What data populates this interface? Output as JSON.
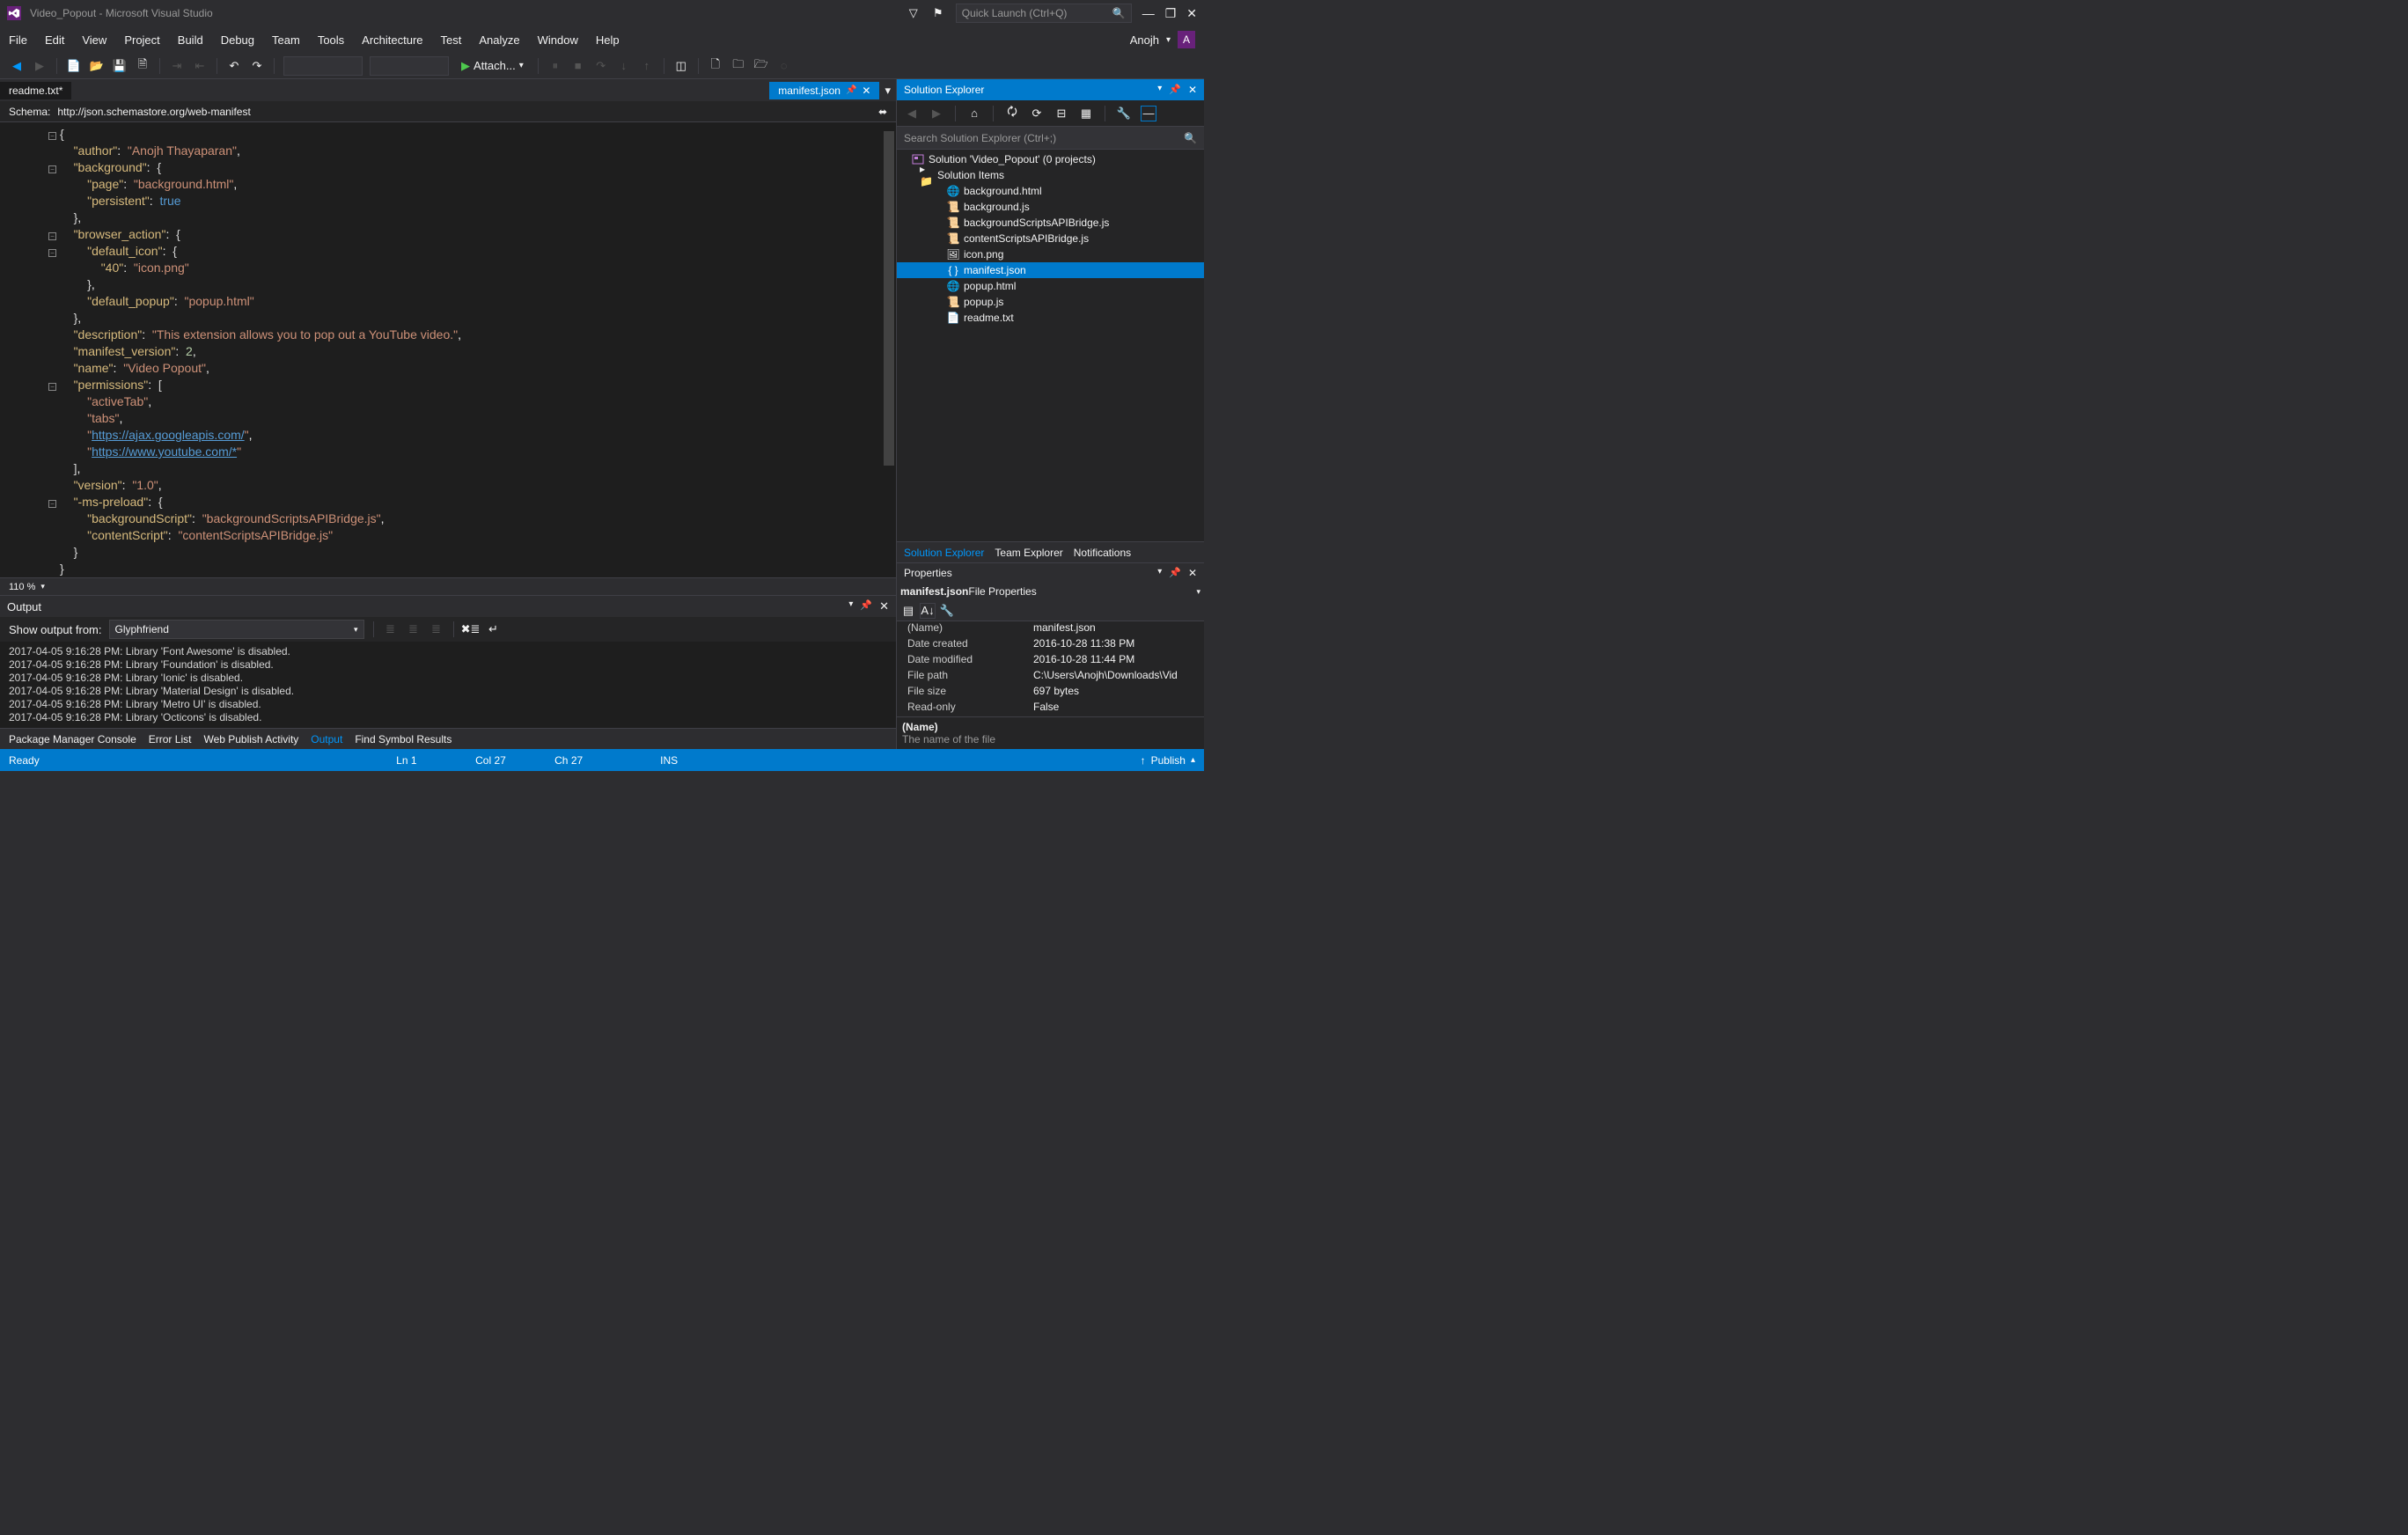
{
  "window": {
    "title": "Video_Popout - Microsoft Visual Studio",
    "quicklaunch_placeholder": "Quick Launch (Ctrl+Q)"
  },
  "menubar": [
    "File",
    "Edit",
    "View",
    "Project",
    "Build",
    "Debug",
    "Team",
    "Tools",
    "Architecture",
    "Test",
    "Analyze",
    "Window",
    "Help"
  ],
  "user": {
    "name": "Anojh",
    "initial": "A"
  },
  "toolbar": {
    "attach": "Attach..."
  },
  "tabs": {
    "left": "readme.txt*",
    "right": "manifest.json"
  },
  "schema": {
    "label": "Schema:",
    "url": "http://json.schemastore.org/web-manifest"
  },
  "code_manifest": {
    "author": "Anojh Thayaparan",
    "background": {
      "page": "background.html",
      "persistent": true
    },
    "browser_action": {
      "default_icon": {
        "40": "icon.png"
      },
      "default_popup": "popup.html"
    },
    "description": "This extension allows you to pop out a YouTube video.",
    "manifest_version": 2,
    "name": "Video Popout",
    "permissions": [
      "activeTab",
      "tabs",
      "https://ajax.googleapis.com/",
      "https://www.youtube.com/*"
    ],
    "version": "1.0",
    "-ms-preload": {
      "backgroundScript": "backgroundScriptsAPIBridge.js",
      "contentScript": "contentScriptsAPIBridge.js"
    }
  },
  "zoom": "110 %",
  "output": {
    "title": "Output",
    "from_label": "Show output from:",
    "from_value": "Glyphfriend",
    "lines": [
      "2017-04-05 9:16:28 PM: Library 'Font Awesome' is disabled.",
      "2017-04-05 9:16:28 PM: Library 'Foundation' is disabled.",
      "2017-04-05 9:16:28 PM: Library 'Ionic' is disabled.",
      "2017-04-05 9:16:28 PM: Library 'Material Design' is disabled.",
      "2017-04-05 9:16:28 PM: Library 'Metro UI' is disabled.",
      "2017-04-05 9:16:28 PM: Library 'Octicons' is disabled."
    ]
  },
  "bottom_tabs": [
    "Package Manager Console",
    "Error List",
    "Web Publish Activity",
    "Output",
    "Find Symbol Results"
  ],
  "solution_explorer": {
    "title": "Solution Explorer",
    "search_placeholder": "Search Solution Explorer (Ctrl+;)",
    "root": "Solution 'Video_Popout' (0 projects)",
    "folder": "Solution Items",
    "items": [
      "background.html",
      "background.js",
      "backgroundScriptsAPIBridge.js",
      "contentScriptsAPIBridge.js",
      "icon.png",
      "manifest.json",
      "popup.html",
      "popup.js",
      "readme.txt"
    ],
    "selected": "manifest.json",
    "tabs": [
      "Solution Explorer",
      "Team Explorer",
      "Notifications"
    ]
  },
  "properties": {
    "title": "Properties",
    "header_file": "manifest.json",
    "header_suffix": " File Properties",
    "rows": [
      {
        "name": "(Name)",
        "value": "manifest.json"
      },
      {
        "name": "Date created",
        "value": "2016-10-28 11:38 PM"
      },
      {
        "name": "Date modified",
        "value": "2016-10-28 11:44 PM"
      },
      {
        "name": "File path",
        "value": "C:\\Users\\Anojh\\Downloads\\Vid"
      },
      {
        "name": "File size",
        "value": "697 bytes"
      },
      {
        "name": "Read-only",
        "value": "False"
      }
    ],
    "desc_title": "(Name)",
    "desc_text": "The name of the file"
  },
  "status": {
    "ready": "Ready",
    "ln": "Ln 1",
    "col": "Col 27",
    "ch": "Ch 27",
    "ins": "INS",
    "publish": "Publish"
  }
}
